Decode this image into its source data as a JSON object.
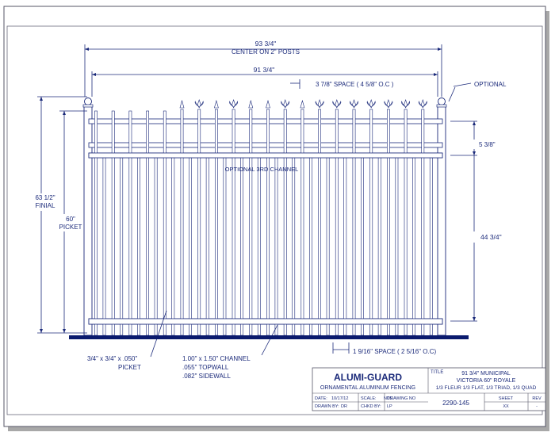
{
  "drawing": {
    "dim_overall": "93 3/4\"",
    "dim_overall_sub": "CENTER ON 2\" POSTS",
    "dim_panel": "91 3/4\"",
    "dim_space_top": "3 7/8\" SPACE ( 4 5/8\" O.C )",
    "optional_label": "OPTIONAL",
    "dim_upper_rail": "5 3/8\"",
    "optional_channel": "OPTIONAL 3RD CHANNEL",
    "dim_finial_value": "63 1/2\"",
    "dim_finial_word": "FINIAL",
    "dim_picket_value": "60\"",
    "dim_picket_word": "PICKET",
    "dim_rail_span": "44 3/4\"",
    "dim_space_bottom": "1 9/16\" SPACE ( 2 5/16\" O.C)",
    "picket_spec_line1": "3/4\" x 3/4\" x .050\"",
    "picket_spec_line2": "PICKET",
    "channel_spec_line1": "1.00\" x 1.50\" CHANNEL",
    "channel_spec_line2": ".055\" TOPWALL",
    "channel_spec_line3": ".082\" SIDEWALL"
  },
  "title_block": {
    "company": "ALUMI-GUARD",
    "subtitle": "ORNAMENTAL ALUMINUM FENCING",
    "title_label": "TITLE",
    "title_line1": "91 3/4\" MUNICIPAL",
    "title_line2": "VICTORIA 60\" ROYALE",
    "title_line3": "1/3 FLEUR 1/3 FLAT, 1/3 TRIAD, 1/3 QUAD",
    "date_label": "DATE:",
    "date_value": "10/17/12",
    "scale_label": "SCALE:",
    "scale_value": "NTS",
    "drawn_label": "DRAWN BY:",
    "drawn_value": "DR",
    "chkd_label": "CHKD BY:",
    "chkd_value": "LP",
    "drawing_no_label": "DRAWING NO",
    "drawing_no": "2290-145",
    "sheet_label": "SHEET",
    "sheet_value": "XX",
    "rev_label": "REV",
    "rev_value": "-"
  },
  "colors": {
    "line": "#1b2a7a",
    "ground": "#0a1a6e",
    "border": "#555566",
    "shadow": "#9a9a9a"
  }
}
